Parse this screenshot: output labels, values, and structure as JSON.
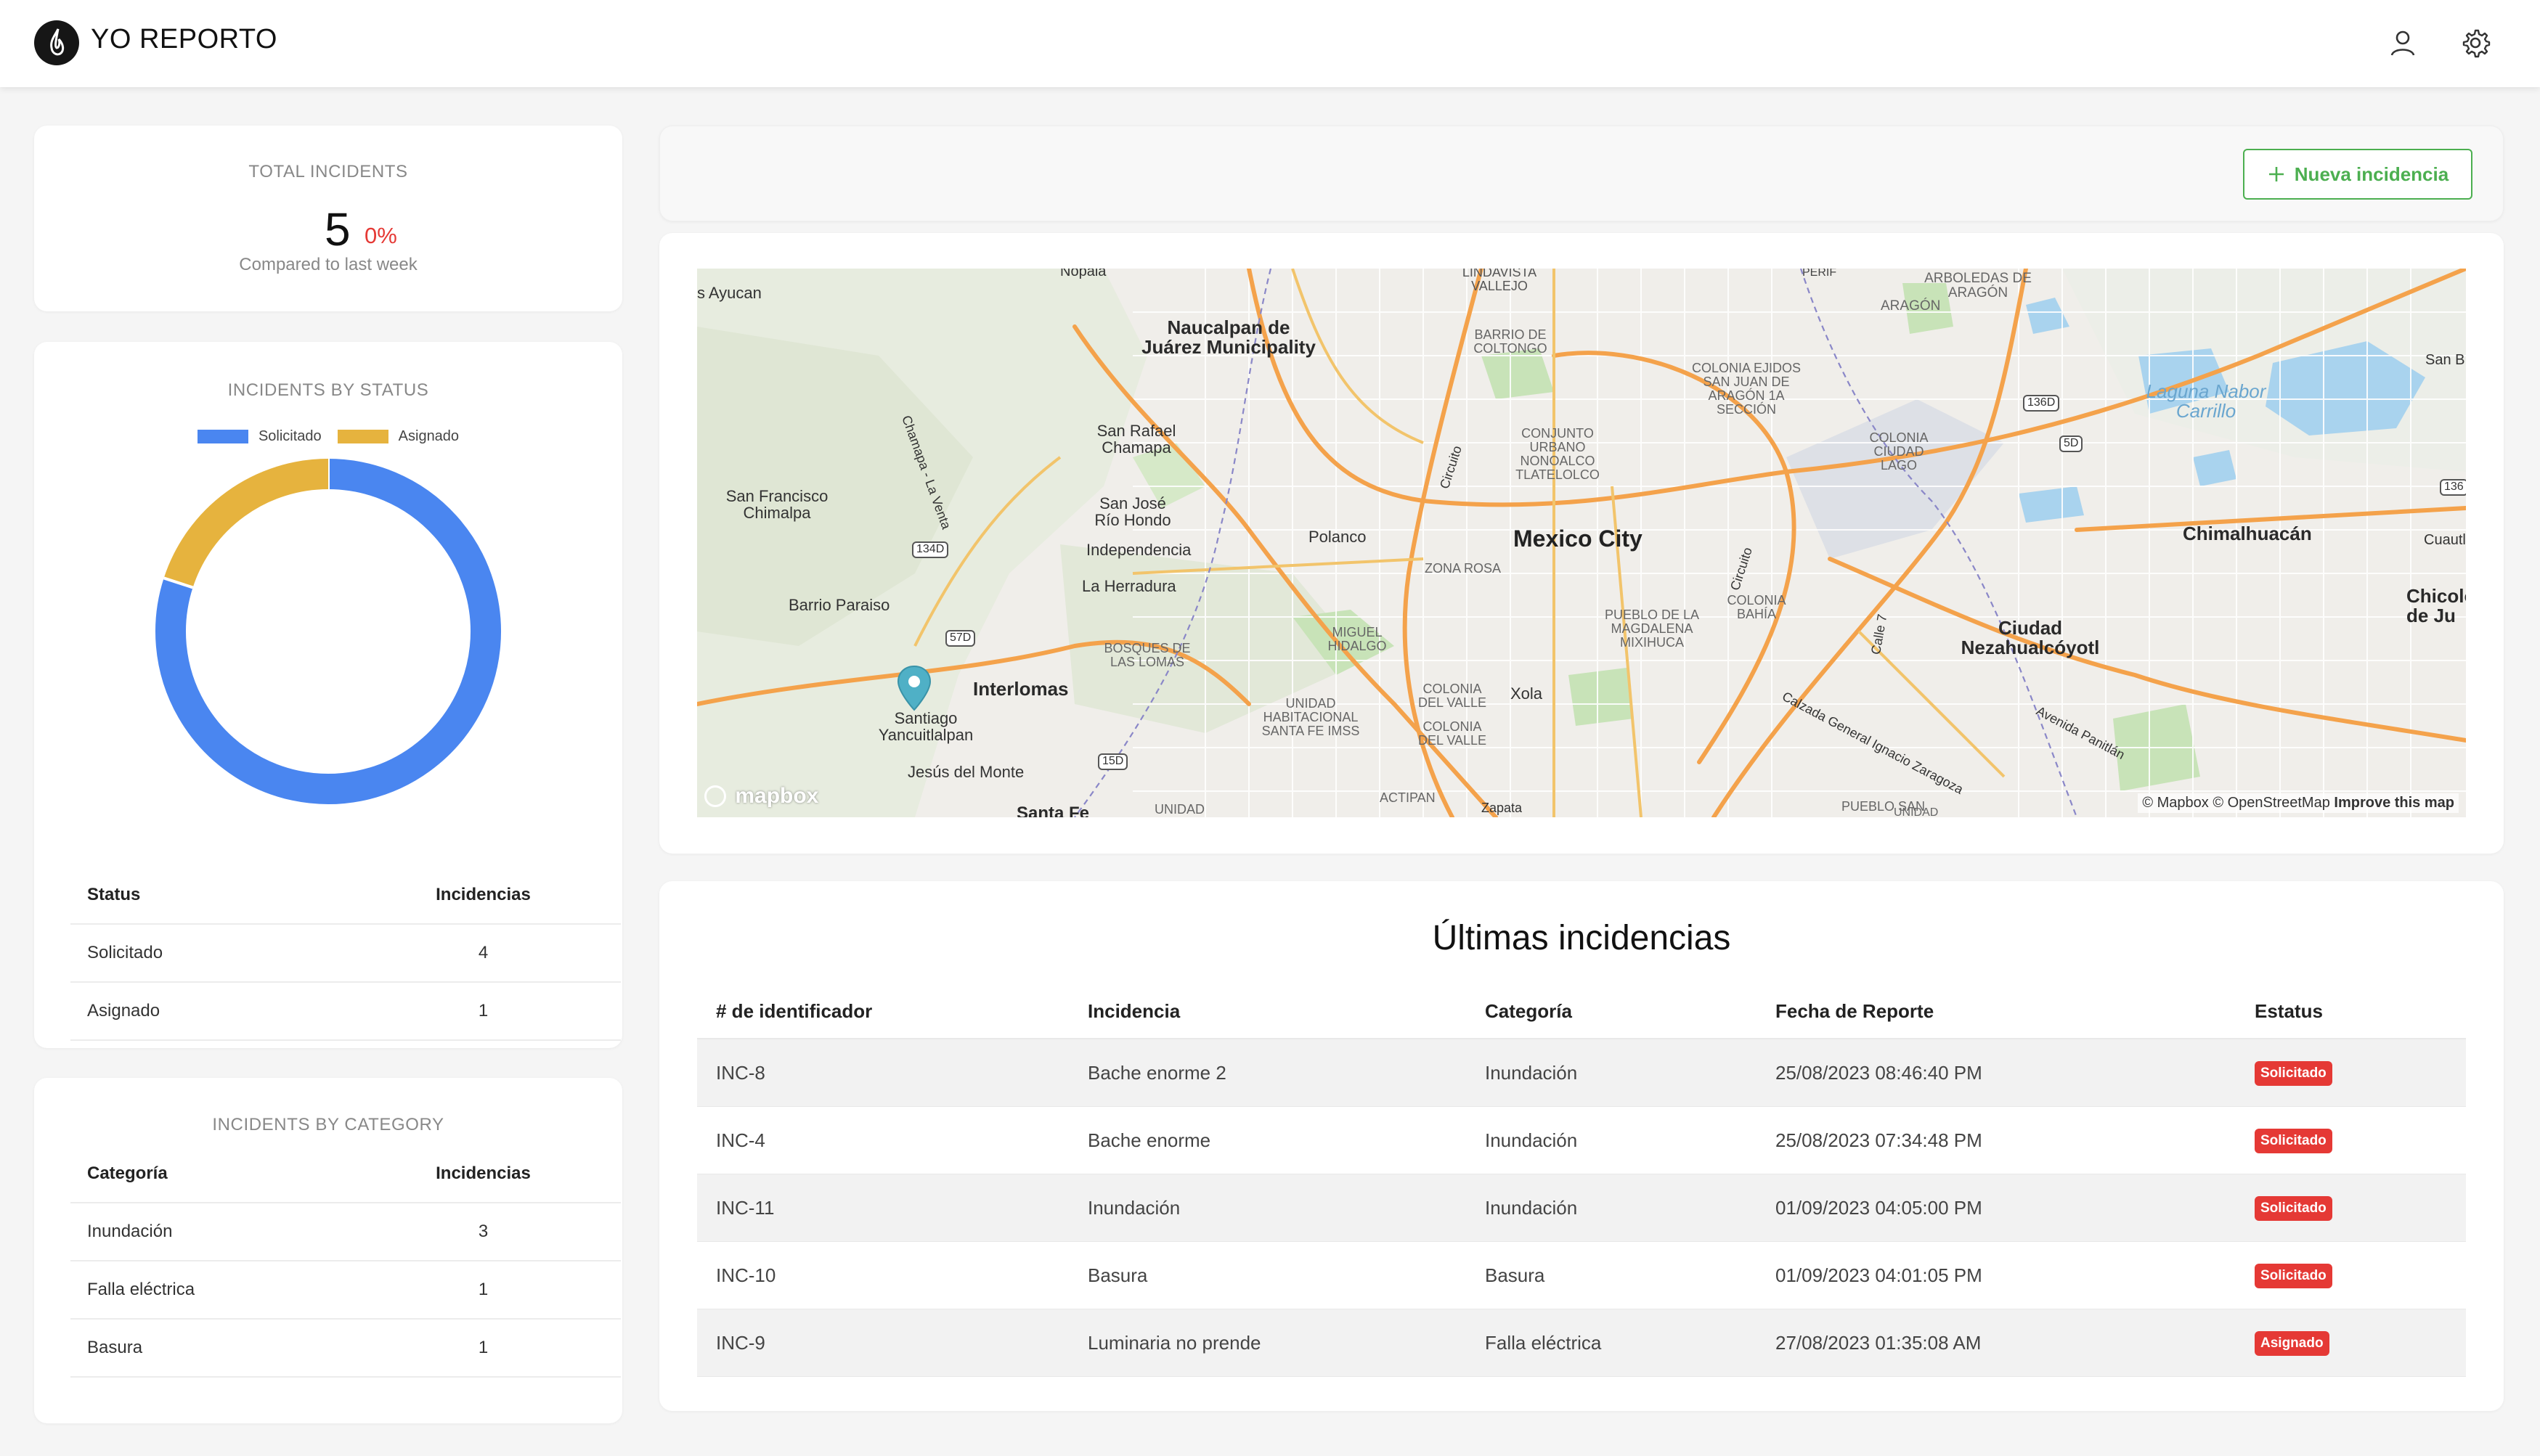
{
  "header": {
    "brand": "YO REPORTO",
    "logo_icon": "flame-logo-icon",
    "user_icon": "user-icon",
    "settings_icon": "gear-icon"
  },
  "total": {
    "title": "TOTAL INCIDENTS",
    "value": "5",
    "change": "0%",
    "compare_text": "Compared to last week"
  },
  "by_status": {
    "title": "INCIDENTS BY STATUS",
    "legend": [
      {
        "label": "Solicitado",
        "color": "#4a86f0"
      },
      {
        "label": "Asignado",
        "color": "#e6b33e"
      }
    ],
    "headers": {
      "status": "Status",
      "count": "Incidencias"
    },
    "rows": [
      {
        "status": "Solicitado",
        "count": "4"
      },
      {
        "status": "Asignado",
        "count": "1"
      }
    ]
  },
  "chart_data": {
    "type": "pie",
    "variant": "donut",
    "title": "INCIDENTS BY STATUS",
    "categories": [
      "Solicitado",
      "Asignado"
    ],
    "values": [
      4,
      1
    ],
    "colors": [
      "#4a86f0",
      "#e6b33e"
    ],
    "legend": "top"
  },
  "by_category": {
    "title": "INCIDENTS BY CATEGORY",
    "headers": {
      "category": "Categoría",
      "count": "Incidencias"
    },
    "rows": [
      {
        "category": "Inundación",
        "count": "3"
      },
      {
        "category": "Falla eléctrica",
        "count": "1"
      },
      {
        "category": "Basura",
        "count": "1"
      }
    ]
  },
  "toolbar": {
    "new_button": "Nueva incidencia",
    "new_icon": "plus-icon"
  },
  "map": {
    "labels": {
      "ayucan": "s Ayucan",
      "nopala": "Nopala",
      "naucalpan": "Naucalpan de Juárez Municipality",
      "lindavista": "LINDAVISTA VALLEJO",
      "perif": "PERIF",
      "arboledas": "ARBOLEDAS DE ARAGÓN",
      "aragon": "ARAGÓN",
      "barrio": "BARRIO DE COLTONGO",
      "colonia_ejidos": "COLONIA EJIDOS SAN JUAN DE ARAGÓN 1A SECCIÓN",
      "san_rafael": "San Rafael Chamapa",
      "conjunto": "CONJUNTO URBANO NONOALCO TLATELOLCO",
      "colonia_lago": "COLONIA CIUDAD LAGO",
      "laguna": "Laguna Nabor Carrillo",
      "san_b": "San B",
      "sf_chimalpa": "San Francisco Chimalpa",
      "san_jose": "San José Río Hondo",
      "polanco": "Polanco",
      "mexico_city": "Mexico City",
      "chimalhuacan": "Chimalhuacán",
      "cuautl": "Cuautl",
      "independencia": "Independencia",
      "zona_rosa": "ZONA ROSA",
      "la_herradura": "La Herradura",
      "barrio_paraiso": "Barrio Paraiso",
      "miguel_hidalgo": "MIGUEL HIDALGO",
      "pueblo_magdalena": "PUEBLO DE LA MAGDALENA MIXIHUCA",
      "colonia_bahia": "COLONIA BAHÍA",
      "ciudad_neza": "Ciudad Nezahualcóyotl",
      "chicolo": "Chicolo de Ju",
      "bosques": "BOSQUES DE LAS LOMAS",
      "interlomas": "Interlomas",
      "santiago": "Santiago Yancuitlalpan",
      "unidad": "UNIDAD HABITACIONAL SANTA FE IMSS",
      "colonia_valle": "COLONIA DEL VALLE",
      "xola": "Xola",
      "colonia_valle2": "COLONIA DEL VALLE",
      "calzada": "Calzada General Ignacio Zaragoza",
      "av_panitlan": "Avenida Panitlán",
      "jesus_monte": "Jesús del Monte",
      "santa_fe": "Santa Fe",
      "unidad2": "UNIDAD",
      "actipan": "ACTIPAN",
      "zapata": "Zapata",
      "pueblo_san": "PUEBLO SAN",
      "unidad3": "UNIDAD",
      "circuito": "Circuito",
      "circuito2": "Circuito",
      "calle7": "Calle 7",
      "chamapa": "Chamapa - La Venta",
      "r1340": "134D",
      "r57d": "57D",
      "r15d": "15D",
      "r136d": "136D",
      "r5d": "5D",
      "r136": "136"
    },
    "logo": "mapbox",
    "attribution": "© Mapbox © OpenStreetMap",
    "improve": "Improve this map",
    "pin_icon": "map-pin-icon"
  },
  "incidents": {
    "title": "Últimas incidencias",
    "headers": {
      "id": "# de identificador",
      "name": "Incidencia",
      "category": "Categoría",
      "date": "Fecha de Reporte",
      "status": "Estatus"
    },
    "rows": [
      {
        "id": "INC-8",
        "name": "Bache enorme 2",
        "category": "Inundación",
        "date": "25/08/2023 08:46:40 PM",
        "status": "Solicitado"
      },
      {
        "id": "INC-4",
        "name": "Bache enorme",
        "category": "Inundación",
        "date": "25/08/2023 07:34:48 PM",
        "status": "Solicitado"
      },
      {
        "id": "INC-11",
        "name": "Inundación",
        "category": "Inundación",
        "date": "01/09/2023 04:05:00 PM",
        "status": "Solicitado"
      },
      {
        "id": "INC-10",
        "name": "Basura",
        "category": "Basura",
        "date": "01/09/2023 04:01:05 PM",
        "status": "Solicitado"
      },
      {
        "id": "INC-9",
        "name": "Luminaria no prende",
        "category": "Falla eléctrica",
        "date": "27/08/2023 01:35:08 AM",
        "status": "Asignado"
      }
    ]
  }
}
